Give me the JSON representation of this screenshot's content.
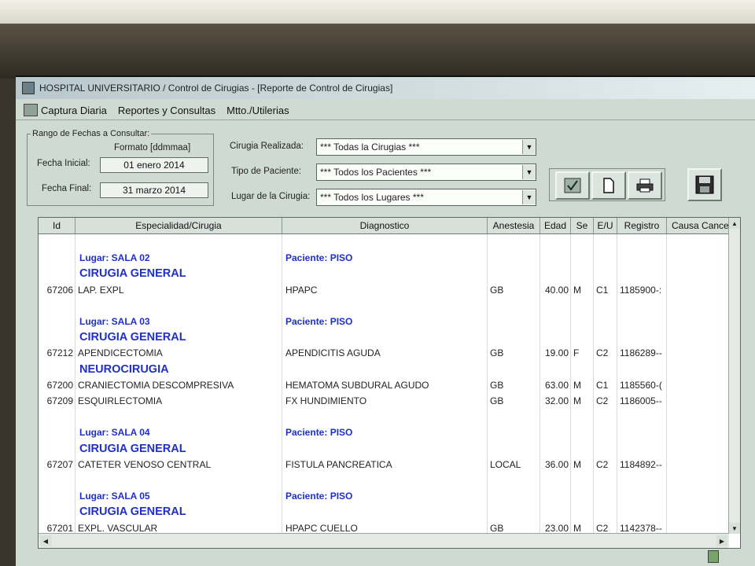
{
  "window": {
    "title": "HOSPITAL UNIVERSITARIO / Control de Cirugias - [Reporte de Control de Cirugias]"
  },
  "menu": [
    "Captura Diaria",
    "Reportes y Consultas",
    "Mtto./Utilerias"
  ],
  "range": {
    "legend": "Rango de Fechas a Consultar:",
    "format_label": "Formato [ddmmaa]",
    "start_label": "Fecha Inicial:",
    "start_value": "01 enero 2014",
    "end_label": "Fecha Final:",
    "end_value": "31 marzo 2014"
  },
  "filters": {
    "cirugia_label": "Cirugia Realizada:",
    "cirugia_value": "*** Todas la Cirugias ***",
    "paciente_label": "Tipo de Paciente:",
    "paciente_value": "*** Todos los Pacientes ***",
    "lugar_label": "Lugar de la Cirugia:",
    "lugar_value": "*** Todos los Lugares ***"
  },
  "toolbar": {
    "accept_icon": "checkmark-icon",
    "new_icon": "document-icon",
    "print_icon": "printer-icon",
    "save_icon": "floppy-disk-icon"
  },
  "columns": [
    "Id",
    "Especialidad/Cirugia",
    "Diagnostico",
    "Anestesia",
    "Edad",
    "Se",
    "E/U",
    "Registro",
    "Causa Cance"
  ],
  "rows": [
    {
      "type": "blank"
    },
    {
      "type": "group",
      "lugar": "Lugar: SALA 02",
      "paciente": "Paciente: PISO"
    },
    {
      "type": "specialty",
      "name": "CIRUGIA GENERAL"
    },
    {
      "type": "data",
      "id": "67206",
      "cirugia": "LAP. EXPL",
      "diagnostico": "HPAPC",
      "anestesia": "GB",
      "edad": "40.00",
      "sexo": "M",
      "eu": "C1",
      "registro": "1185900-:"
    },
    {
      "type": "blank"
    },
    {
      "type": "group",
      "lugar": "Lugar: SALA 03",
      "paciente": "Paciente: PISO"
    },
    {
      "type": "specialty",
      "name": "CIRUGIA GENERAL"
    },
    {
      "type": "data",
      "id": "67212",
      "cirugia": "APENDICECTOMIA",
      "diagnostico": "APENDICITIS AGUDA",
      "anestesia": "GB",
      "edad": "19.00",
      "sexo": "F",
      "eu": "C2",
      "registro": "1186289--"
    },
    {
      "type": "specialty",
      "name": "NEUROCIRUGIA"
    },
    {
      "type": "data",
      "id": "67200",
      "cirugia": "CRANIECTOMIA DESCOMPRESIVA",
      "diagnostico": "HEMATOMA SUBDURAL AGUDO",
      "anestesia": "GB",
      "edad": "63.00",
      "sexo": "M",
      "eu": "C1",
      "registro": "1185560-("
    },
    {
      "type": "data",
      "id": "67209",
      "cirugia": "ESQUIRLECTOMIA",
      "diagnostico": "FX HUNDIMIENTO",
      "anestesia": "GB",
      "edad": "32.00",
      "sexo": "M",
      "eu": "C2",
      "registro": "1186005--"
    },
    {
      "type": "blank"
    },
    {
      "type": "group",
      "lugar": "Lugar: SALA 04",
      "paciente": "Paciente: PISO"
    },
    {
      "type": "specialty",
      "name": "CIRUGIA GENERAL"
    },
    {
      "type": "data",
      "id": "67207",
      "cirugia": "CATETER VENOSO CENTRAL",
      "diagnostico": "FISTULA PANCREATICA",
      "anestesia": "LOCAL",
      "edad": "36.00",
      "sexo": "M",
      "eu": "C2",
      "registro": "1184892--"
    },
    {
      "type": "blank"
    },
    {
      "type": "group",
      "lugar": "Lugar: SALA 05",
      "paciente": "Paciente: PISO"
    },
    {
      "type": "specialty",
      "name": "CIRUGIA GENERAL"
    },
    {
      "type": "data",
      "id": "67201",
      "cirugia": "EXPL. VASCULAR",
      "diagnostico": "HPAPC CUELLO",
      "anestesia": "GB",
      "edad": "23.00",
      "sexo": "M",
      "eu": "C2",
      "registro": "1142378--"
    }
  ]
}
